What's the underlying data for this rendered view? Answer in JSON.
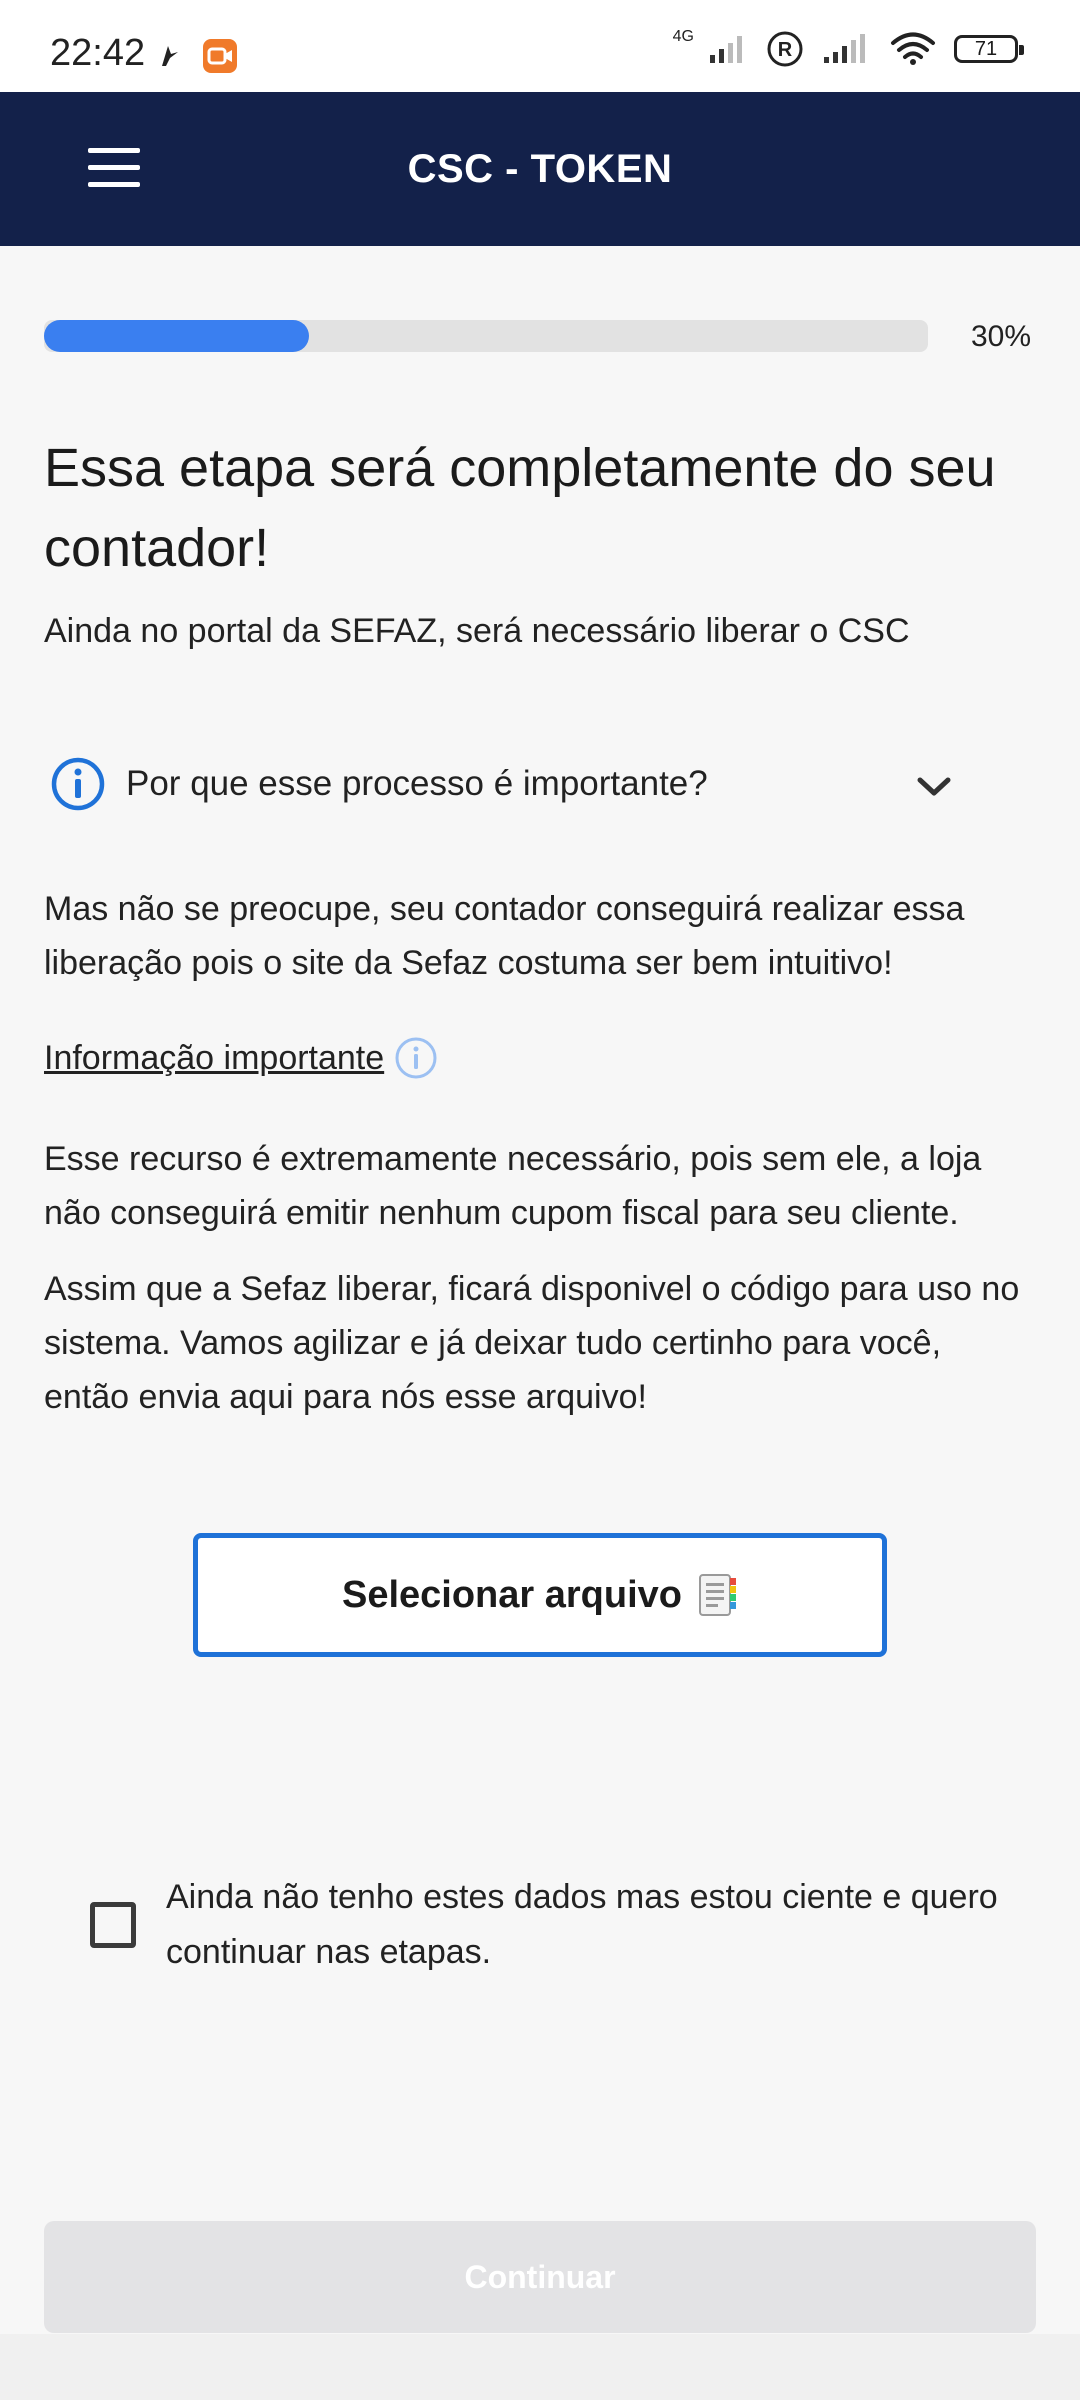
{
  "status_bar": {
    "time": "22:42",
    "network": "4G",
    "battery": "71"
  },
  "app_bar": {
    "title": "CSC - TOKEN"
  },
  "progress": {
    "percent": 30,
    "label": "30%"
  },
  "content": {
    "heading": "Essa etapa será completamente do seu contador!",
    "subtitle": "Ainda no portal da SEFAZ, será necessário liberar o CSC",
    "accordion_label": "Por que esse processo é importante?",
    "reassurance": "Mas não se preocupe, seu contador conseguirá realizar essa liberação pois o site da Sefaz costuma ser bem intuitivo!",
    "important_link": "Informação importante",
    "necessity": "Esse recurso é extremamente necessário, pois sem ele, a loja não conseguirá emitir nenhum cupom fiscal para seu cliente.",
    "instructions": "Assim que a Sefaz liberar, ficará disponivel o código para uso no sistema. Vamos agilizar e já deixar tudo certinho para você, então envia aqui para nós esse arquivo!"
  },
  "file_button": {
    "label": "Selecionar arquivo"
  },
  "acknowledge": {
    "label": "Ainda não tenho estes dados mas estou ciente e quero continuar nas etapas.",
    "checked": false
  },
  "continue_button": {
    "label": "Continuar"
  },
  "colors": {
    "app_bar": "#13214a",
    "progress_fill": "#3a7ff0",
    "accent_blue": "#1f72d8",
    "disabled_button": "#e3e3e5"
  }
}
